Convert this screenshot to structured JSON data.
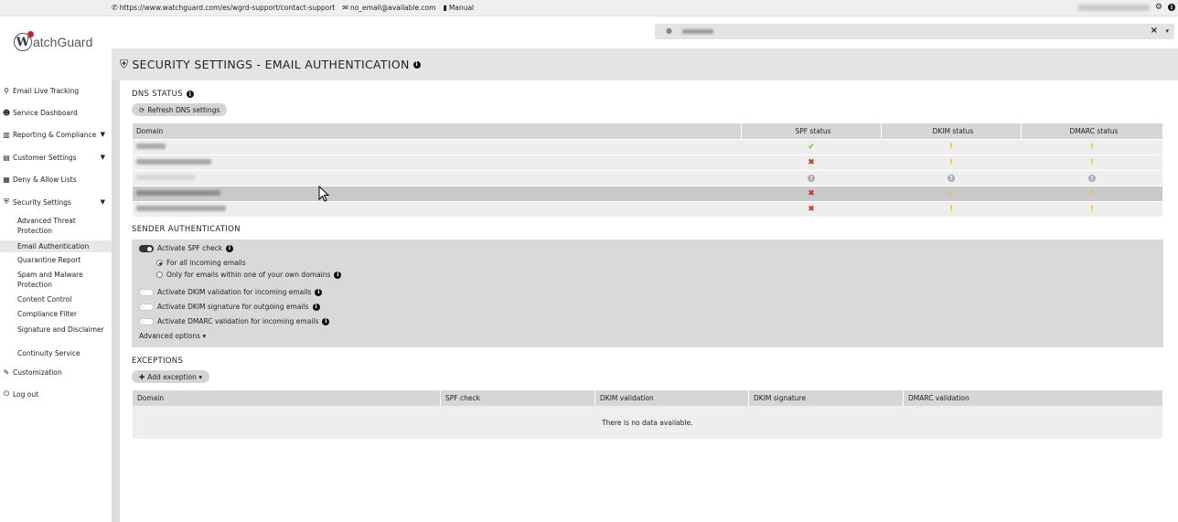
{
  "topbar": {
    "support_url": "https://www.watchguard.com/es/wgrd-support/contact-support",
    "email": "no_email@available.com",
    "manual": "Manual"
  },
  "logo": {
    "letter": "W",
    "text": "atchGuard"
  },
  "user_box": {
    "close": "×",
    "caret": "▾"
  },
  "page": {
    "title": "SECURITY SETTINGS - EMAIL AUTHENTICATION"
  },
  "sidebar": {
    "items": [
      {
        "label": "Email Live Tracking",
        "icon": "search-icon"
      },
      {
        "label": "Service Dashboard",
        "icon": "users-icon"
      },
      {
        "label": "Reporting & Compliance",
        "icon": "chart-icon"
      },
      {
        "label": "Customer Settings",
        "icon": "id-card-icon"
      },
      {
        "label": "Deny & Allow Lists",
        "icon": "list-icon"
      },
      {
        "label": "Security Settings",
        "icon": "shield-icon"
      },
      {
        "label": "Customization",
        "icon": "brush-icon"
      },
      {
        "label": "Log out",
        "icon": "power-icon"
      }
    ],
    "security_sub": [
      {
        "label": "Advanced Threat Protection"
      },
      {
        "label": "Email Authentication"
      },
      {
        "label": "Quarantine Report"
      },
      {
        "label": "Spam and Malware Protection"
      },
      {
        "label": "Content Control"
      },
      {
        "label": "Compliance Filter"
      },
      {
        "label": "Signature and Disclaimer"
      },
      {
        "label": "Continuity Service"
      }
    ]
  },
  "dns": {
    "title": "DNS STATUS",
    "refresh_button": "Refresh DNS settings",
    "columns": [
      "Domain",
      "SPF status",
      "DKIM status",
      "DMARC status"
    ],
    "rows": [
      {
        "spf": "ok",
        "dkim": "warn",
        "dmarc": "warn"
      },
      {
        "spf": "fail",
        "dkim": "warn",
        "dmarc": "warn"
      },
      {
        "spf": "unknown",
        "dkim": "unknown",
        "dmarc": "unknown"
      },
      {
        "spf": "fail",
        "dkim": "warn",
        "dmarc": "warn"
      },
      {
        "spf": "fail",
        "dkim": "warn",
        "dmarc": "warn"
      }
    ]
  },
  "sender": {
    "title": "SENDER AUTHENTICATION",
    "spf_check": "Activate SPF check",
    "spf_all": "For all incoming emails",
    "spf_own": "Only for emails within one of your own domains",
    "dkim_validation": "Activate DKIM validation for incoming emails",
    "dkim_signature": "Activate DKIM signature for outgoing emails",
    "dmarc_validation": "Activate DMARC validation for incoming emails",
    "advanced": "Advanced options ▾"
  },
  "exceptions": {
    "title": "EXCEPTIONS",
    "add_button": "Add exception ▾",
    "columns": [
      "Domain",
      "SPF check",
      "DKIM validation",
      "DKIM signature",
      "DMARC validation"
    ],
    "empty": "There is no data available."
  }
}
